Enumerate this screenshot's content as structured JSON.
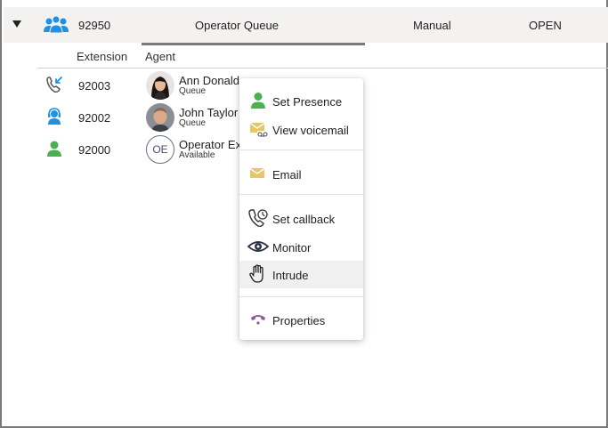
{
  "group": {
    "number": "92950",
    "name": "Operator Queue",
    "mode": "Manual",
    "status": "OPEN",
    "icon": "people-group-icon",
    "icon_color": "#1e90e6"
  },
  "columns": {
    "extension": "Extension",
    "agent": "Agent"
  },
  "agents": [
    {
      "extension": "92003",
      "name": "Ann Donald",
      "status": "Queue",
      "icon": "phone-incoming-icon",
      "avatar": "photo"
    },
    {
      "extension": "92002",
      "name": "John Taylor",
      "status": "Queue",
      "icon": "headset-agent-icon",
      "avatar": "photo"
    },
    {
      "extension": "92000",
      "name": "Operator Ex",
      "status": "Available",
      "icon": "person-available-icon",
      "avatar": "initials",
      "initials": "OE"
    }
  ],
  "context_menu": {
    "items": [
      {
        "label": "Set Presence",
        "icon": "person-presence-icon"
      },
      {
        "label": "View voicemail",
        "icon": "voicemail-envelope-icon"
      },
      {
        "label": "Email",
        "icon": "email-envelope-icon"
      },
      {
        "label": "Set callback",
        "icon": "callback-clock-icon"
      },
      {
        "label": "Monitor",
        "icon": "eye-icon"
      },
      {
        "label": "Intrude",
        "icon": "hand-icon"
      },
      {
        "label": "Properties",
        "icon": "phone-handset-icon"
      }
    ],
    "highlighted": "Intrude"
  },
  "colors": {
    "accent_blue": "#1e90e6",
    "available_green": "#4caf50",
    "envelope_yellow": "#e8c46a",
    "properties_purple": "#8c5a9a",
    "header_bg": "#f3f2f1"
  }
}
